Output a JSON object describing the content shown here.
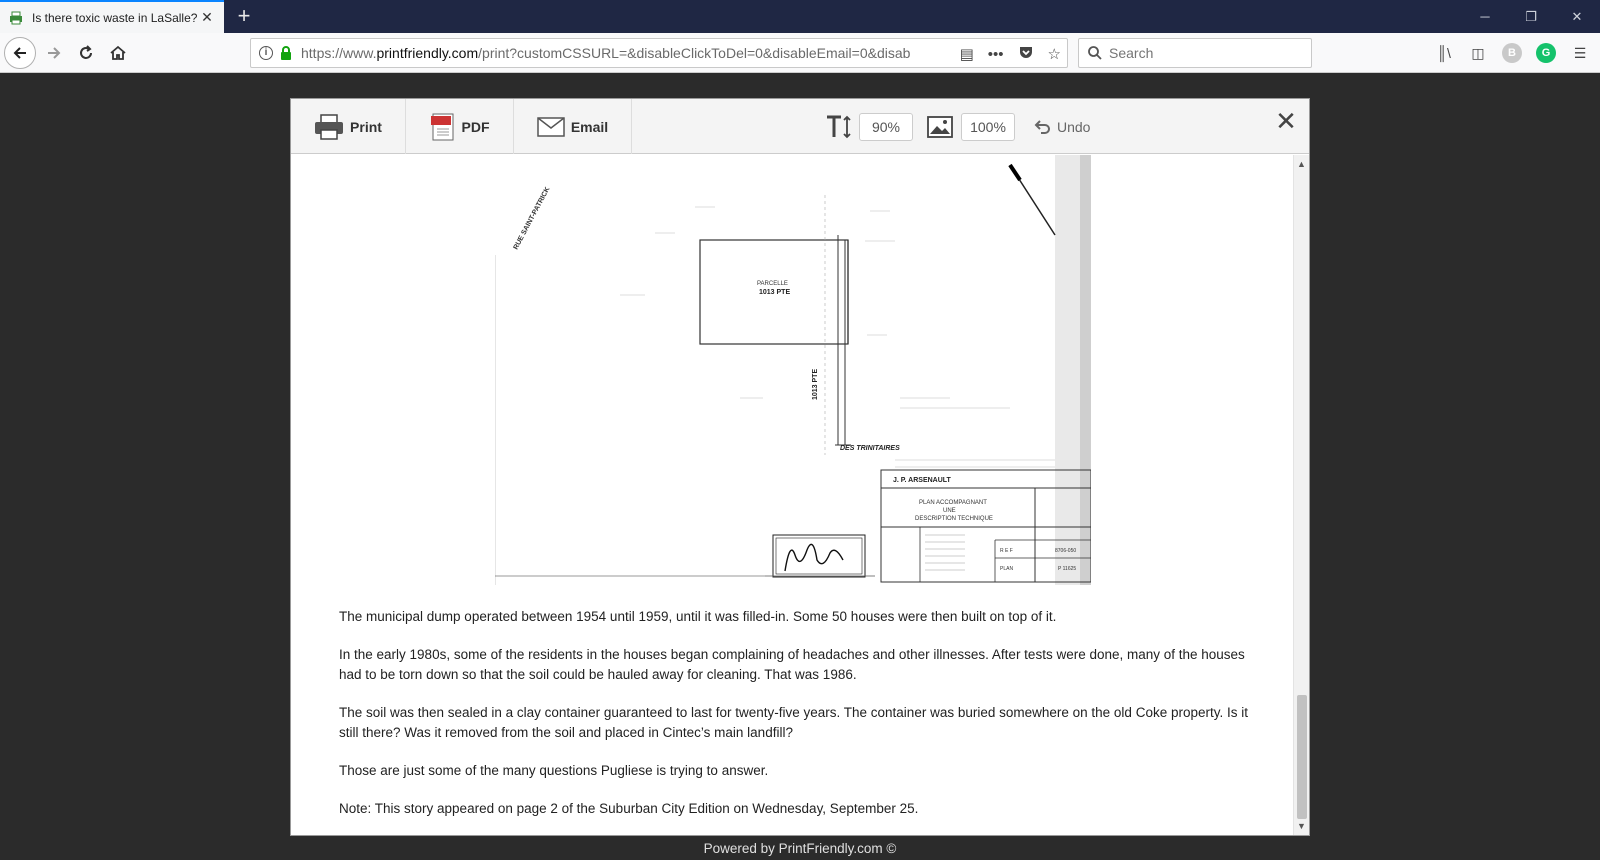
{
  "browser": {
    "tab_title": "Is there toxic waste in LaSalle?",
    "url_prefix": "https://www.",
    "url_domain": "printfriendly.com",
    "url_rest": "/print?customCSSURL=&disableClickToDel=0&disableEmail=0&disab",
    "search_placeholder": "Search",
    "ext_b_label": "B",
    "ext_g_label": "G"
  },
  "toolbar": {
    "print_label": "Print",
    "pdf_label": "PDF",
    "email_label": "Email",
    "text_size": "90%",
    "image_size": "100%",
    "undo_label": "Undo"
  },
  "plan": {
    "parcel_name": "PARCELLE",
    "parcel_lot": "1013 PTE",
    "street_label": "RUE SAINT-PATRICK",
    "boulevard_label": "DES TRINITAIRES",
    "surveyor": "J. P. ARSENAULT",
    "plan_title_1": "PLAN ACCOMPAGNANT",
    "plan_title_2": "UNE",
    "plan_title_3": "DESCRIPTION TECHNIQUE",
    "ref_label": "R E F",
    "ref_value": "8706-050",
    "plan_label": "PLAN",
    "plan_value": "P 11625"
  },
  "article": {
    "p1": "The municipal dump operated between 1954 until 1959, until it was filled-in. Some 50 houses were then built on top of it.",
    "p2": "In the early 1980s, some of the residents in the houses began complaining of headaches and other illnesses. After tests were done, many of the houses had to be torn down so that the soil could be hauled away for cleaning. That was 1986.",
    "p3": "The soil was then sealed in a clay container guaranteed to last for twenty-five years. The container was buried somewhere on the old Coke property. Is it still there? Was it removed from the soil and placed in Cintec’s main landfill?",
    "p4": "Those are just some of the many questions Pugliese is trying to answer.",
    "p5": "Note: This story appeared on page 2 of the Suburban City Edition on Wednesday, September 25."
  },
  "footer": {
    "text": "Powered by PrintFriendly.com ©"
  }
}
